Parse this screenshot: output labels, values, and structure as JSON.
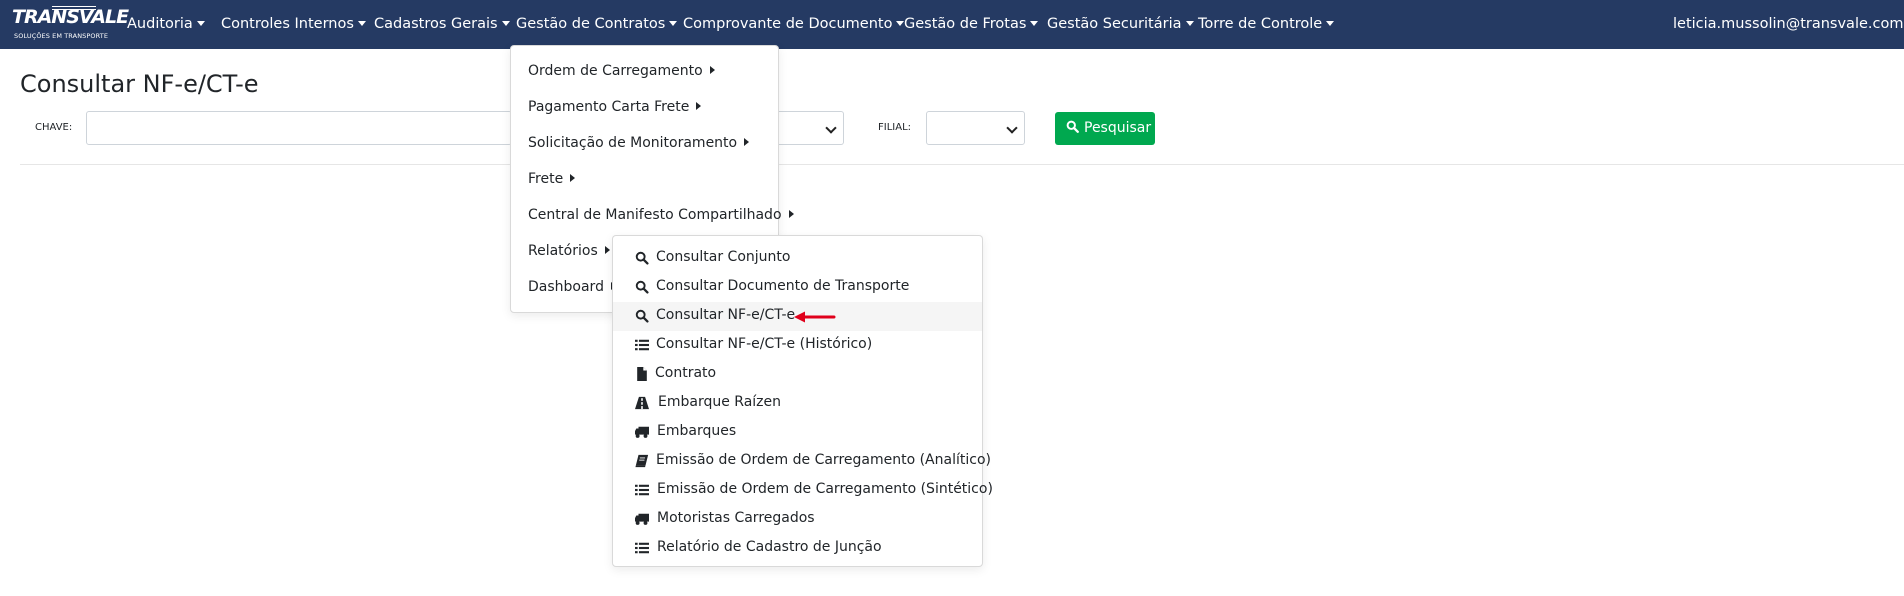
{
  "brand": {
    "name": "TRANSVALE",
    "tagline": "SOLUÇÕES EM TRANSPORTE"
  },
  "colors": {
    "navbar": "#253a63",
    "search_button": "#00a84f",
    "arrow": "#e0001b"
  },
  "nav": {
    "items": [
      {
        "label": "Auditoria"
      },
      {
        "label": "Controles Internos"
      },
      {
        "label": "Cadastros Gerais"
      },
      {
        "label": "Gestão de Contratos"
      },
      {
        "label": "Comprovante de Documento"
      },
      {
        "label": "Gestão de Frotas"
      },
      {
        "label": "Gestão Securitária"
      },
      {
        "label": "Torre de Controle"
      }
    ],
    "user": "leticia.mussolin@transvale.com.br"
  },
  "page": {
    "title": "Consultar NF-e/CT-e",
    "chave_label": "CHAVE:",
    "chave_value": "",
    "filial_label": "FILIAL:",
    "filial_value": "",
    "search_button": "Pesquisar"
  },
  "menu_contratos": [
    {
      "label": "Ordem de Carregamento"
    },
    {
      "label": "Pagamento Carta Frete"
    },
    {
      "label": "Solicitação de Monitoramento"
    },
    {
      "label": "Frete"
    },
    {
      "label": "Central de Manifesto Compartilhado"
    },
    {
      "label": "Relatórios"
    },
    {
      "label": "Dashboard"
    }
  ],
  "menu_relatorios": [
    {
      "label": "Consultar Conjunto",
      "icon": "search-icon"
    },
    {
      "label": "Consultar Documento de Transporte",
      "icon": "search-icon"
    },
    {
      "label": "Consultar NF-e/CT-e",
      "icon": "search-icon",
      "active": true
    },
    {
      "label": "Consultar NF-e/CT-e (Histórico)",
      "icon": "list-icon"
    },
    {
      "label": "Contrato",
      "icon": "file-icon"
    },
    {
      "label": "Embarque Raízen",
      "icon": "road-icon"
    },
    {
      "label": "Embarques",
      "icon": "truck-icon"
    },
    {
      "label": "Emissão de Ordem de Carregamento (Analítico)",
      "icon": "book-icon"
    },
    {
      "label": "Emissão de Ordem de Carregamento (Sintético)",
      "icon": "list-icon"
    },
    {
      "label": "Motoristas Carregados",
      "icon": "truck-icon"
    },
    {
      "label": "Relatório de Cadastro de Junção",
      "icon": "list-icon"
    }
  ]
}
